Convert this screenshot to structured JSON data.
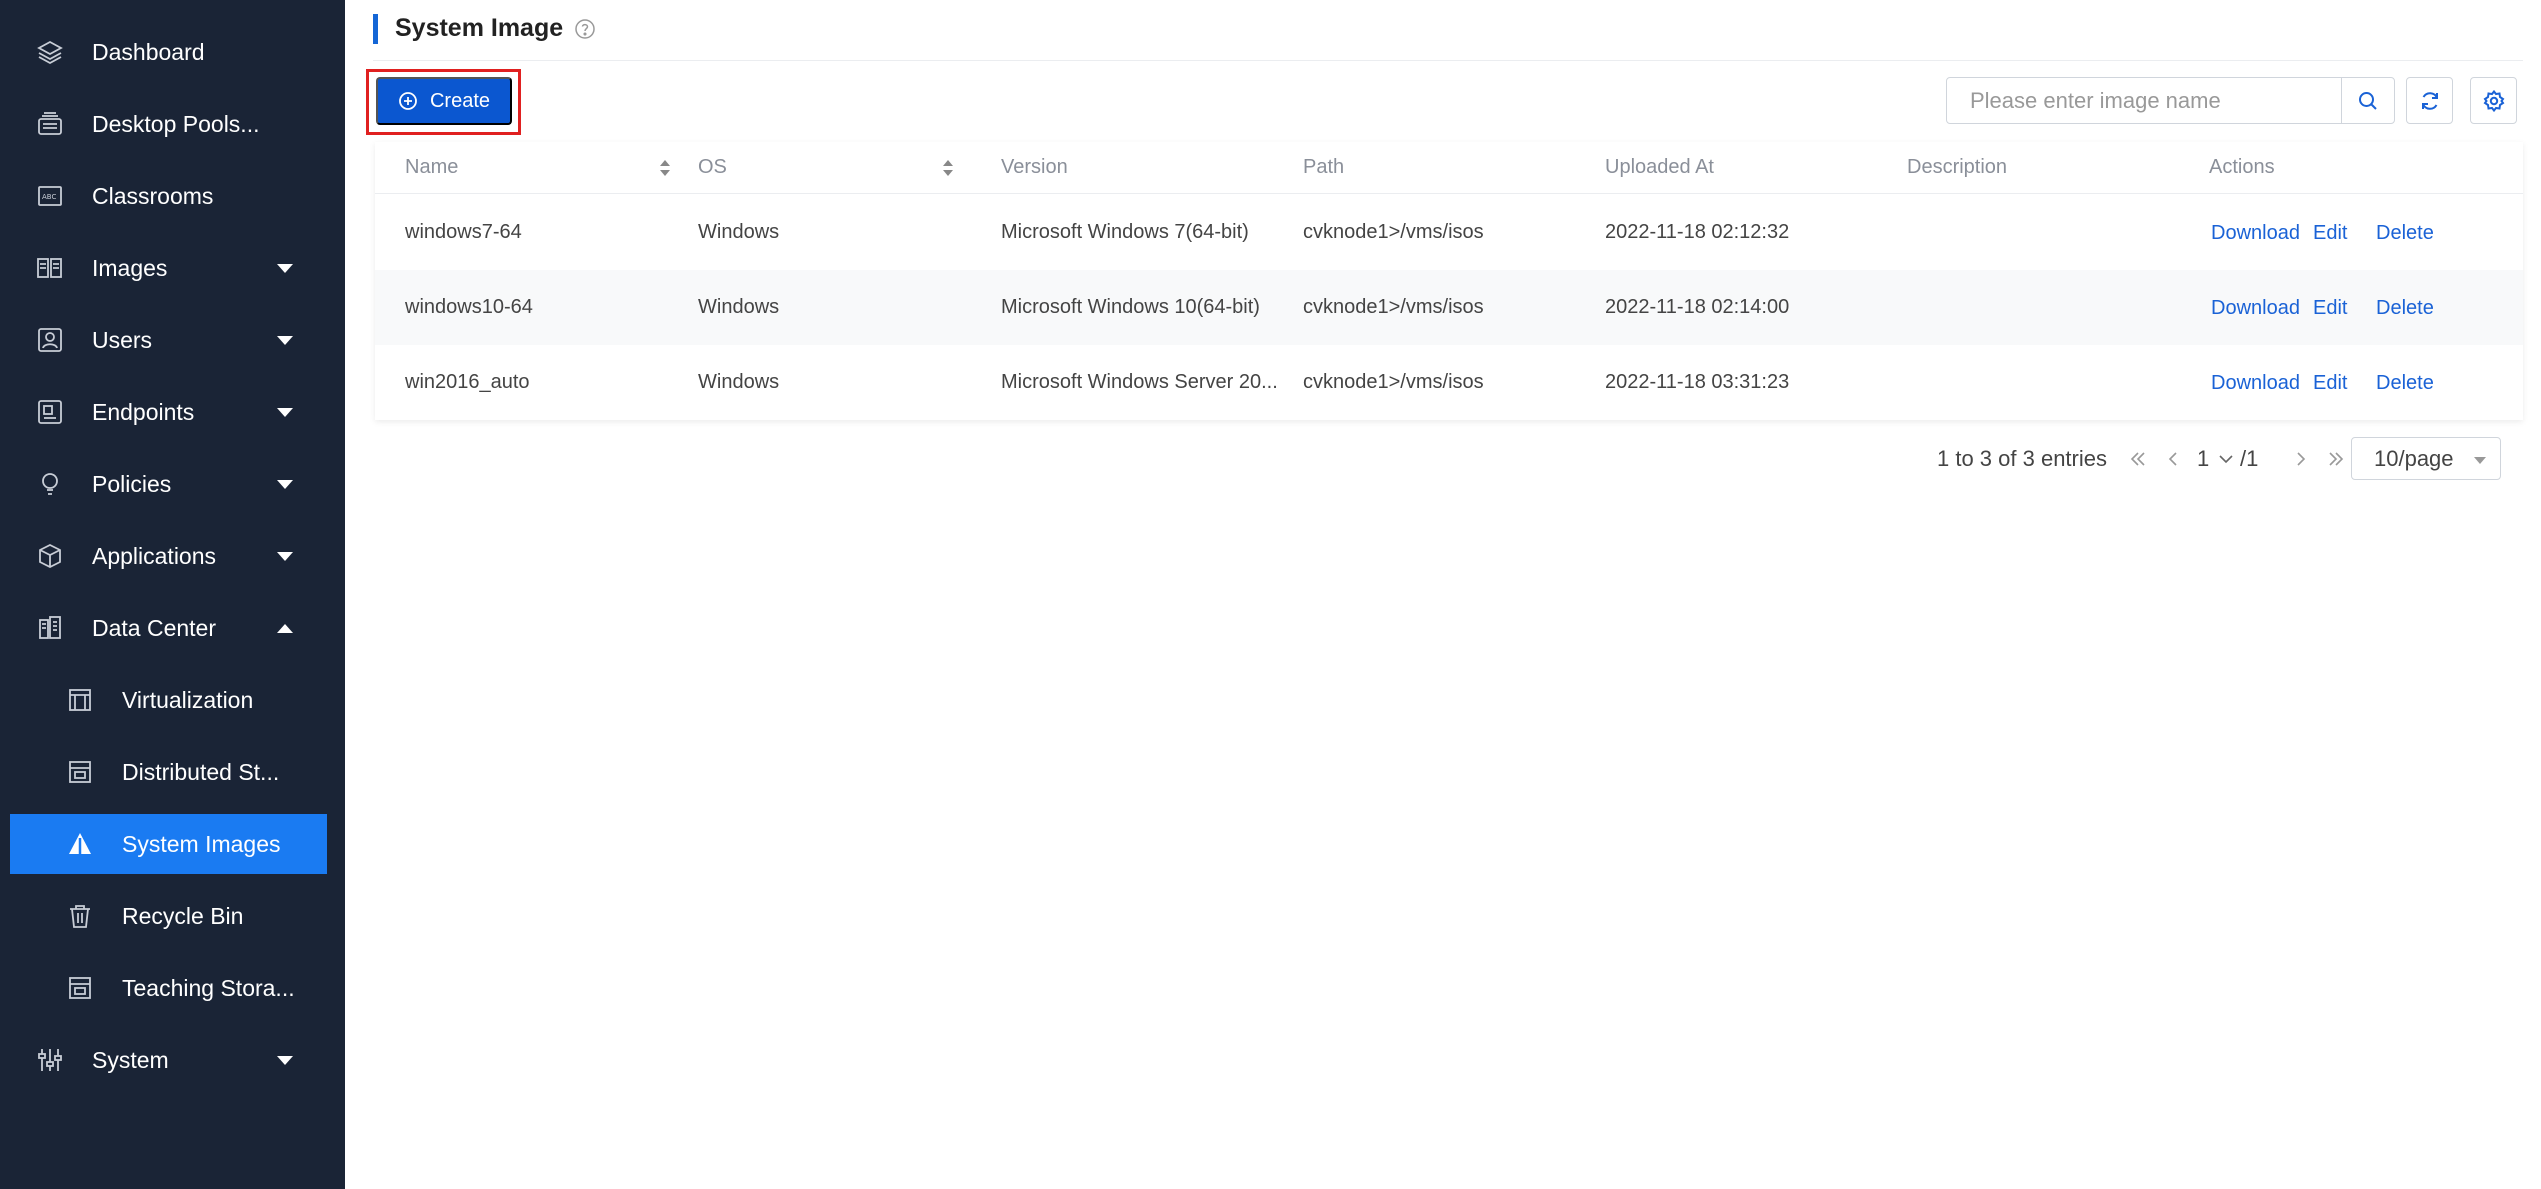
{
  "sidebar": {
    "items": [
      {
        "label": "Dashboard",
        "icon": "layers-icon"
      },
      {
        "label": "Desktop Pools...",
        "icon": "desktop-pool-icon"
      },
      {
        "label": "Classrooms",
        "icon": "classroom-icon"
      },
      {
        "label": "Images",
        "icon": "images-icon",
        "expandable": true
      },
      {
        "label": "Users",
        "icon": "user-icon",
        "expandable": true
      },
      {
        "label": "Endpoints",
        "icon": "endpoint-icon",
        "expandable": true
      },
      {
        "label": "Policies",
        "icon": "bulb-icon",
        "expandable": true
      },
      {
        "label": "Applications",
        "icon": "cube-icon",
        "expandable": true
      },
      {
        "label": "Data Center",
        "icon": "building-icon",
        "expanded": true
      },
      {
        "label": "Virtualization",
        "icon": "server-icon",
        "child": true
      },
      {
        "label": "Distributed St...",
        "icon": "storage-icon",
        "child": true
      },
      {
        "label": "System Images",
        "icon": "warning-triangle-icon",
        "child": true,
        "active": true
      },
      {
        "label": "Recycle Bin",
        "icon": "trash-icon",
        "child": true
      },
      {
        "label": "Teaching Stora...",
        "icon": "storage-icon",
        "child": true
      },
      {
        "label": "System",
        "icon": "sliders-icon",
        "expandable": true
      }
    ]
  },
  "header": {
    "title": "System Image"
  },
  "toolbar": {
    "create_label": "Create",
    "search_placeholder": "Please enter image name"
  },
  "table": {
    "columns": [
      "Name",
      "OS",
      "Version",
      "Path",
      "Uploaded At",
      "Description",
      "Actions"
    ],
    "rows": [
      {
        "name": "windows7-64",
        "os": "Windows",
        "version": "Microsoft Windows 7(64-bit)",
        "path": "cvknode1>/vms/isos",
        "uploaded": "2022-11-18 02:12:32",
        "description": ""
      },
      {
        "name": "windows10-64",
        "os": "Windows",
        "version": "Microsoft Windows 10(64-bit)",
        "path": "cvknode1>/vms/isos",
        "uploaded": "2022-11-18 02:14:00",
        "description": ""
      },
      {
        "name": "win2016_auto",
        "os": "Windows",
        "version": "Microsoft Windows Server 20...",
        "path": "cvknode1>/vms/isos",
        "uploaded": "2022-11-18 03:31:23",
        "description": ""
      }
    ],
    "actions": [
      "Download",
      "Edit",
      "Delete"
    ]
  },
  "pagination": {
    "summary": "1 to 3 of 3 entries",
    "current_page": "1",
    "total_pages": "/1",
    "page_size": "10/page"
  },
  "colors": {
    "sidebar_bg": "#1a2436",
    "active_item": "#1a7bf2",
    "primary_button": "#0b57d0",
    "link": "#1a62d6",
    "highlight_outline": "#e02020"
  }
}
